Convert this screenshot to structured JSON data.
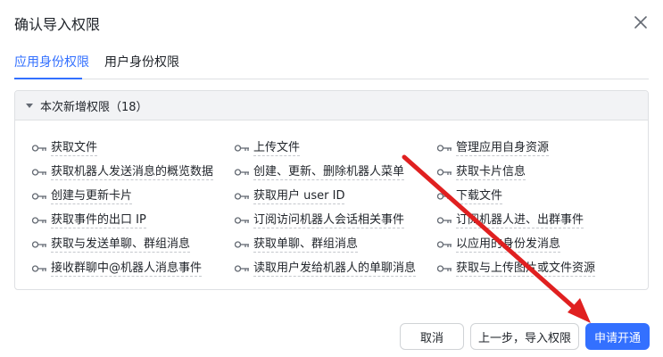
{
  "dialog": {
    "title": "确认导入权限",
    "close_icon": "close-icon"
  },
  "tabs": [
    {
      "label": "应用身份权限",
      "active": true
    },
    {
      "label": "用户身份权限",
      "active": false
    }
  ],
  "panel": {
    "header": "本次新增权限（18）",
    "rows": [
      [
        "获取文件",
        "上传文件",
        "管理应用自身资源"
      ],
      [
        "获取机器人发送消息的概览数据",
        "创建、更新、删除机器人菜单",
        "获取卡片信息"
      ],
      [
        "创建与更新卡片",
        "获取用户 user ID",
        "下载文件"
      ],
      [
        "获取事件的出口 IP",
        "订阅访问机器人会话相关事件",
        "订阅机器人进、出群事件"
      ],
      [
        "获取与发送单聊、群组消息",
        "获取单聊、群组消息",
        "以应用的身份发消息"
      ],
      [
        "接收群聊中@机器人消息事件",
        "读取用户发给机器人的单聊消息",
        "获取与上传图片或文件资源"
      ]
    ]
  },
  "footer": {
    "cancel_label": "取消",
    "prev_label": "上一步，导入权限",
    "apply_label": "申请开通"
  },
  "colors": {
    "accent": "#3370ff",
    "annotation_arrow": "#e02020"
  }
}
